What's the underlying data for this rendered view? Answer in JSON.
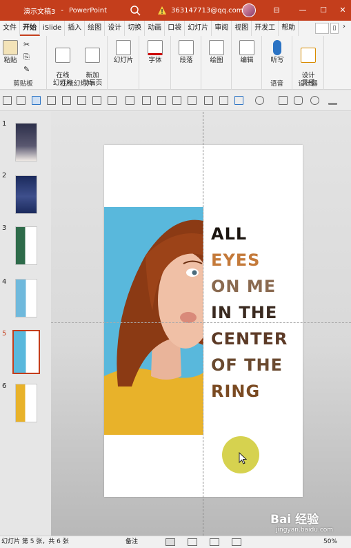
{
  "titlebar": {
    "doc_name": "演示文稿3",
    "separator": "-",
    "app_name": "PowerPoint",
    "account": "363147713@qq.com",
    "accent": "#c43e1c"
  },
  "tabs": [
    "文件",
    "开始",
    "iSlide",
    "插入",
    "绘图",
    "设计",
    "切换",
    "动画",
    "口袋",
    "幻灯片",
    "审阅",
    "视图",
    "开发工",
    "帮助"
  ],
  "active_tab": "开始",
  "ribbon": {
    "clipboard": {
      "paste": "粘贴",
      "group": "剪贴板"
    },
    "online": {
      "online_slides": "在线\n幻灯片",
      "new_anim": "新加\n动画页",
      "group": "在线幻灯片"
    },
    "slides": "幻灯片",
    "font": "字体",
    "paragraph": "段落",
    "drawing": "绘图",
    "editing": "编辑",
    "dictate": "听写",
    "voice_group": "语音",
    "designer": "设计\n灵感",
    "designer_group": "设计器"
  },
  "thumbnails": [
    {
      "num": "1"
    },
    {
      "num": "2"
    },
    {
      "num": "3"
    },
    {
      "num": "4"
    },
    {
      "num": "5",
      "selected": true
    },
    {
      "num": "6"
    }
  ],
  "slide": {
    "headline": [
      "ALL",
      "EYES",
      "ON ME",
      "IN THE",
      "CENTER",
      "OF THE",
      "RING"
    ],
    "photo_bg": "#59b8dc",
    "shirt_color": "#e8b22a",
    "hair_color": "#8b3a14"
  },
  "statusbar": {
    "slide_info": "幻灯片 第 5 张，共 6 张",
    "notes": "备注",
    "zoom": "50%"
  },
  "watermark": {
    "logo": "Bai 经验",
    "url": "jingyan.baidu.com"
  }
}
